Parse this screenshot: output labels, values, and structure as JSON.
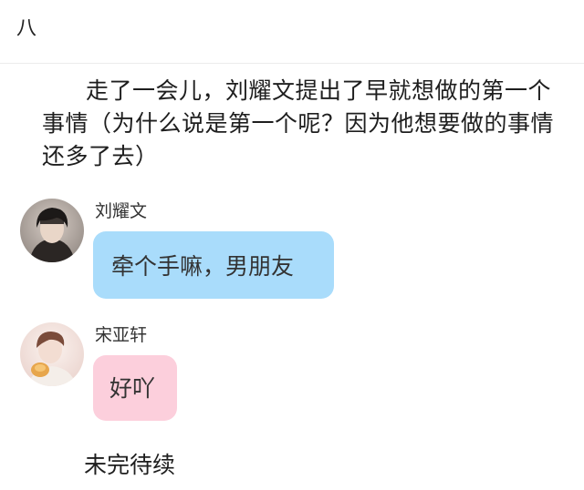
{
  "header": {
    "title": "八"
  },
  "story": {
    "narration": "走了一会儿，刘耀文提出了早就想做的第一个事情（为什么说是第一个呢？因为他想要做的事情还多了去）",
    "ending": "未完待续"
  },
  "messages": [
    {
      "sender": "刘耀文",
      "text": "牵个手嘛，男朋友",
      "bubble_color": "#a9dcfb",
      "avatar_icon": "avatar-dark-hair-icon"
    },
    {
      "sender": "宋亚轩",
      "text": "好吖",
      "bubble_color": "#fccfdc",
      "avatar_icon": "avatar-light-portrait-icon"
    }
  ]
}
